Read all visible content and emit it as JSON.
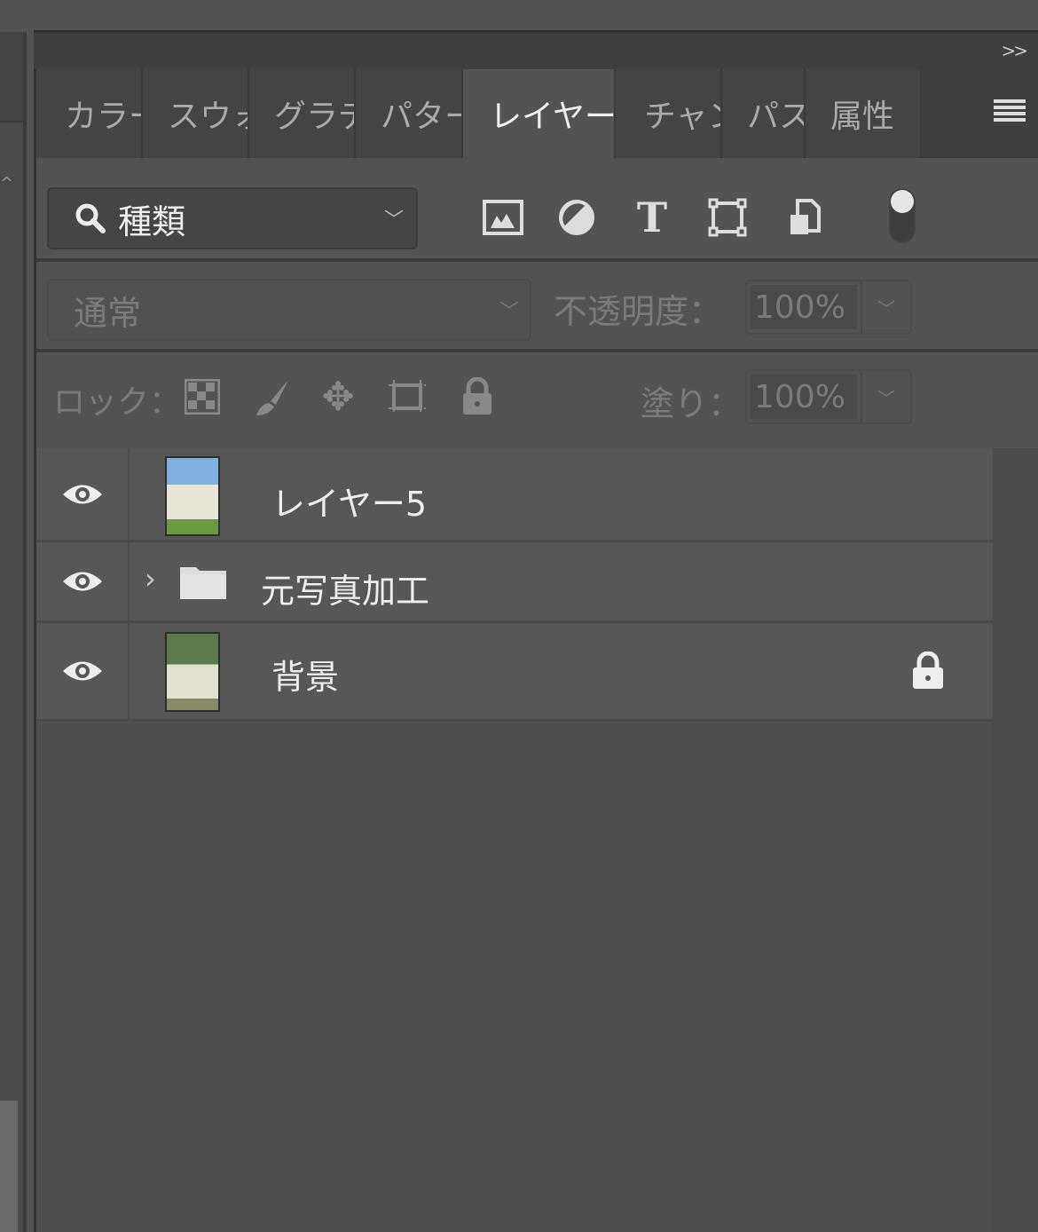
{
  "panel": {
    "collapse_label": ">>",
    "menu_icon": "hamburger-icon"
  },
  "tabs": [
    {
      "label": "カラー"
    },
    {
      "label": "スウォ"
    },
    {
      "label": "グラデ"
    },
    {
      "label": "パター"
    },
    {
      "label": "レイヤー",
      "active": true
    },
    {
      "label": "チャン"
    },
    {
      "label": "パス"
    },
    {
      "label": "属性"
    }
  ],
  "filter": {
    "label": "種類"
  },
  "blend": {
    "mode": "通常",
    "opacity_label": "不透明度：",
    "opacity": "100%"
  },
  "lock": {
    "label": "ロック：",
    "fill_label": "塗り：",
    "fill": "100%"
  },
  "layers": [
    {
      "name": "レイヤー5",
      "type": "image",
      "visible": true
    },
    {
      "name": "元写真加工",
      "type": "group",
      "visible": true
    },
    {
      "name": "背景",
      "type": "image",
      "visible": true,
      "locked": true
    }
  ]
}
